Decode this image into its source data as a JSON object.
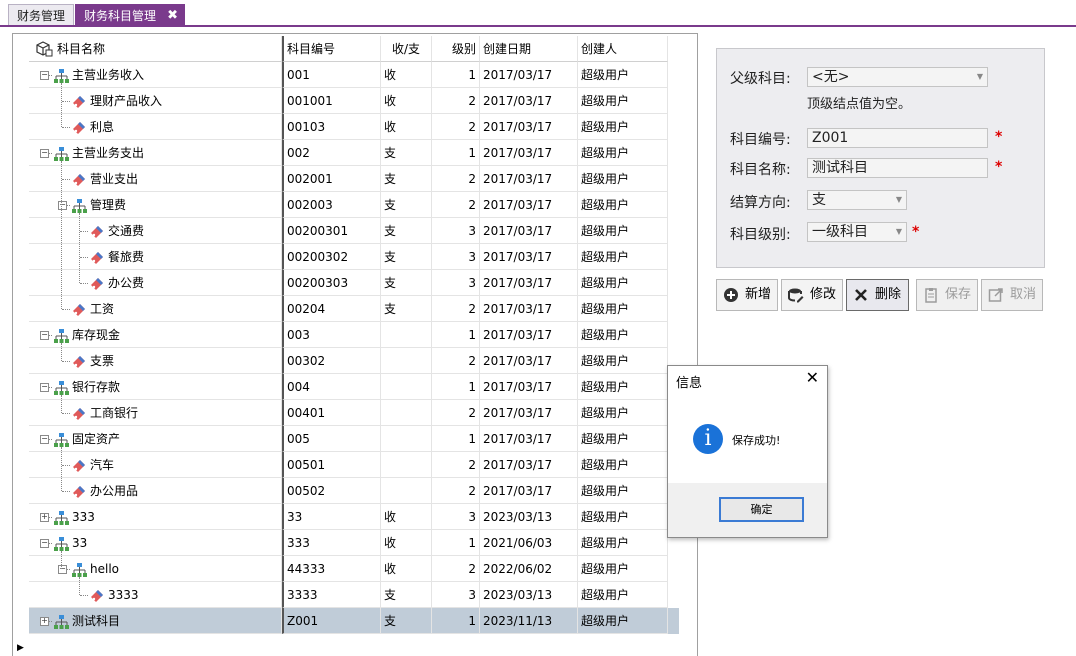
{
  "tabs": [
    {
      "label": "财务管理",
      "active": false
    },
    {
      "label": "财务科目管理",
      "active": true
    }
  ],
  "grid": {
    "columns": {
      "name": "科目名称",
      "code": "科目编号",
      "direction": "收/支",
      "level": "级别",
      "created": "创建日期",
      "creator": "创建人"
    },
    "rows": [
      {
        "name": "主营业务收入",
        "code": "001",
        "direction": "收",
        "level": "1",
        "created": "2017/03/17",
        "creator": "超级用户",
        "depth": 0,
        "type": "folder",
        "expanded": true
      },
      {
        "name": "理财产品收入",
        "code": "001001",
        "direction": "收",
        "level": "2",
        "created": "2017/03/17",
        "creator": "超级用户",
        "depth": 1,
        "type": "leaf"
      },
      {
        "name": "利息",
        "code": "00103",
        "direction": "收",
        "level": "2",
        "created": "2017/03/17",
        "creator": "超级用户",
        "depth": 1,
        "type": "leaf"
      },
      {
        "name": "主营业务支出",
        "code": "002",
        "direction": "支",
        "level": "1",
        "created": "2017/03/17",
        "creator": "超级用户",
        "depth": 0,
        "type": "folder",
        "expanded": true
      },
      {
        "name": "营业支出",
        "code": "002001",
        "direction": "支",
        "level": "2",
        "created": "2017/03/17",
        "creator": "超级用户",
        "depth": 1,
        "type": "leaf"
      },
      {
        "name": "管理费",
        "code": "002003",
        "direction": "支",
        "level": "2",
        "created": "2017/03/17",
        "creator": "超级用户",
        "depth": 1,
        "type": "folder",
        "expanded": true
      },
      {
        "name": "交通费",
        "code": "00200301",
        "direction": "支",
        "level": "3",
        "created": "2017/03/17",
        "creator": "超级用户",
        "depth": 2,
        "type": "leaf"
      },
      {
        "name": "餐旅费",
        "code": "00200302",
        "direction": "支",
        "level": "3",
        "created": "2017/03/17",
        "creator": "超级用户",
        "depth": 2,
        "type": "leaf"
      },
      {
        "name": "办公费",
        "code": "00200303",
        "direction": "支",
        "level": "3",
        "created": "2017/03/17",
        "creator": "超级用户",
        "depth": 2,
        "type": "leaf"
      },
      {
        "name": "工资",
        "code": "00204",
        "direction": "支",
        "level": "2",
        "created": "2017/03/17",
        "creator": "超级用户",
        "depth": 1,
        "type": "leaf"
      },
      {
        "name": "库存现金",
        "code": "003",
        "direction": "",
        "level": "1",
        "created": "2017/03/17",
        "creator": "超级用户",
        "depth": 0,
        "type": "folder",
        "expanded": true
      },
      {
        "name": "支票",
        "code": "00302",
        "direction": "",
        "level": "2",
        "created": "2017/03/17",
        "creator": "超级用户",
        "depth": 1,
        "type": "leaf"
      },
      {
        "name": "银行存款",
        "code": "004",
        "direction": "",
        "level": "1",
        "created": "2017/03/17",
        "creator": "超级用户",
        "depth": 0,
        "type": "folder",
        "expanded": true
      },
      {
        "name": "工商银行",
        "code": "00401",
        "direction": "",
        "level": "2",
        "created": "2017/03/17",
        "creator": "超级用户",
        "depth": 1,
        "type": "leaf"
      },
      {
        "name": "固定资产",
        "code": "005",
        "direction": "",
        "level": "1",
        "created": "2017/03/17",
        "creator": "超级用户",
        "depth": 0,
        "type": "folder",
        "expanded": true
      },
      {
        "name": "汽车",
        "code": "00501",
        "direction": "",
        "level": "2",
        "created": "2017/03/17",
        "creator": "超级用户",
        "depth": 1,
        "type": "leaf"
      },
      {
        "name": "办公用品",
        "code": "00502",
        "direction": "",
        "level": "2",
        "created": "2017/03/17",
        "creator": "超级用户",
        "depth": 1,
        "type": "leaf"
      },
      {
        "name": "333",
        "code": "33",
        "direction": "收",
        "level": "3",
        "created": "2023/03/13",
        "creator": "超级用户",
        "depth": 0,
        "type": "folder",
        "expanded": false
      },
      {
        "name": "33",
        "code": "333",
        "direction": "收",
        "level": "1",
        "created": "2021/06/03",
        "creator": "超级用户",
        "depth": 0,
        "type": "folder",
        "expanded": true
      },
      {
        "name": "hello",
        "code": "44333",
        "direction": "收",
        "level": "2",
        "created": "2022/06/02",
        "creator": "超级用户",
        "depth": 1,
        "type": "folder",
        "expanded": true
      },
      {
        "name": "3333",
        "code": "3333",
        "direction": "支",
        "level": "3",
        "created": "2023/03/13",
        "creator": "超级用户",
        "depth": 2,
        "type": "leaf"
      },
      {
        "name": "测试科目",
        "code": "Z001",
        "direction": "支",
        "level": "1",
        "created": "2023/11/13",
        "creator": "超级用户",
        "depth": 0,
        "type": "folder",
        "expanded": false,
        "selected": true
      }
    ]
  },
  "form": {
    "parent_label": "父级科目:",
    "parent_value": "<无>",
    "parent_hint": "顶级结点值为空。",
    "code_label": "科目编号:",
    "code_value": "Z001",
    "name_label": "科目名称:",
    "name_value": "测试科目",
    "direction_label": "结算方向:",
    "direction_value": "支",
    "level_label": "科目级别:",
    "level_value": "一级科目",
    "required_mark": "*"
  },
  "buttons": {
    "add": "新增",
    "edit": "修改",
    "delete": "删除",
    "save": "保存",
    "cancel": "取消"
  },
  "dialog": {
    "title": "信息",
    "message": "保存成功!",
    "ok": "确定",
    "close": "✕",
    "info_glyph": "i"
  },
  "colors": {
    "tab_active": "#7a3a8c",
    "selected_row": "#c0ccd8",
    "required": "#dd0000",
    "info_icon": "#1a72d8"
  }
}
